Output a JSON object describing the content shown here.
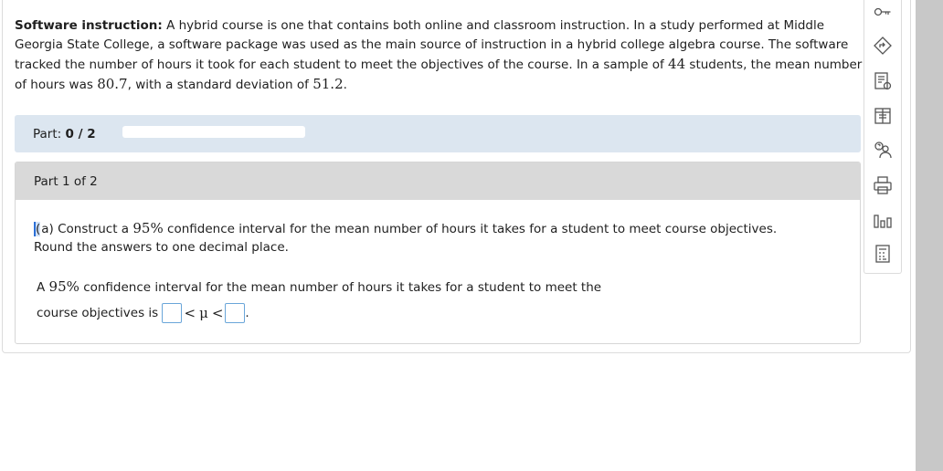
{
  "problem": {
    "lead": "Software instruction:",
    "text1": "A hybrid course is one that contains both online and classroom instruction. In a study performed at Middle Georgia State College, a software package was used as the main source of instruction in a hybrid college algebra course. The software tracked the number of hours it took for each student to meet the objectives of the course. In a sample of",
    "n": "44",
    "text2": "students, the mean number of hours was",
    "mean": "80.7",
    "text3": ", with a standard deviation of",
    "sd": "51.2",
    "text4": "."
  },
  "part_bar": {
    "label": "Part:",
    "value": "0 / 2",
    "progress_fraction": 0
  },
  "part": {
    "header": "Part 1 of 2",
    "q_prefix": "(",
    "q_a": "a) Construct a",
    "q_conf": "95%",
    "q_rest": "confidence interval for the mean number of hours it takes for a student to meet course objectives.",
    "q_round": "Round the answers to one decimal place.",
    "ans_pre": "A",
    "ans_conf": "95%",
    "ans_text": "confidence interval for the mean number of hours it takes for a student to meet the",
    "ans_text2": "course objectives is",
    "lt1": "<",
    "mu": "μ",
    "lt2": "<",
    "period": ".",
    "lower_value": "",
    "upper_value": ""
  },
  "toolbar": {
    "icons": [
      "key-icon",
      "navigate-icon",
      "checklist-icon",
      "textbook-icon",
      "ask-tutor-icon",
      "print-icon",
      "statistics-icon",
      "calculator-icon"
    ]
  },
  "colors": {
    "part_bar_bg": "#dce6f0",
    "input_border": "#6aa6d9",
    "scroll_track": "#c8c8c8"
  }
}
